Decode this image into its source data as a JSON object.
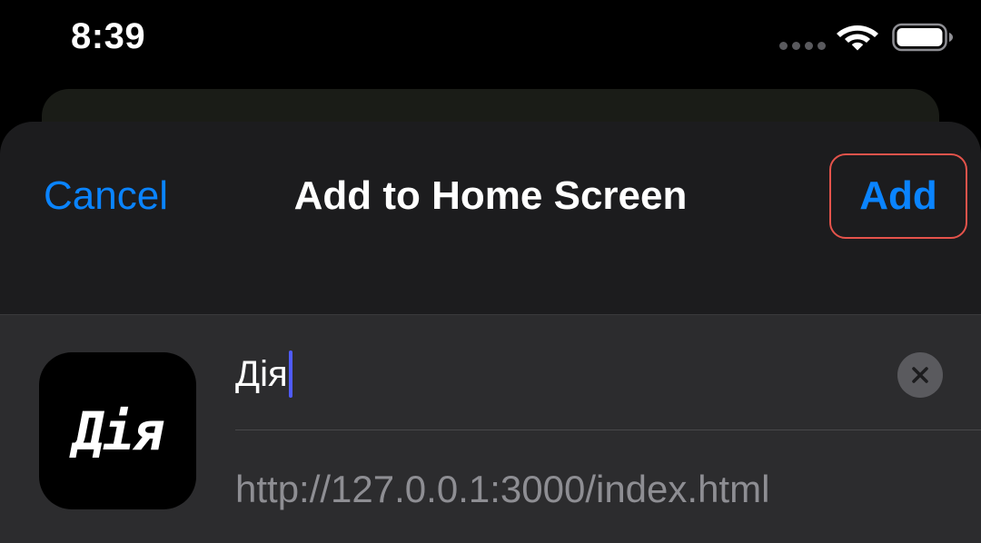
{
  "status_bar": {
    "time": "8:39",
    "signal_icon": "signal-dots-icon",
    "wifi_icon": "wifi-icon",
    "battery_icon": "battery-icon",
    "battery_level": 1.0
  },
  "sheet": {
    "cancel_label": "Cancel",
    "title": "Add to Home Screen",
    "add_label": "Add",
    "app_icon_text": "Дія",
    "name_value": "Дія",
    "url": "http://127.0.0.1:3000/index.html",
    "clear_icon": "clear-x-icon"
  },
  "colors": {
    "accent": "#0a84ff",
    "sheet_background": "#1c1c1e",
    "form_background": "#2c2c2e",
    "highlight_border": "#e5534b",
    "caret": "#4f5bff"
  }
}
